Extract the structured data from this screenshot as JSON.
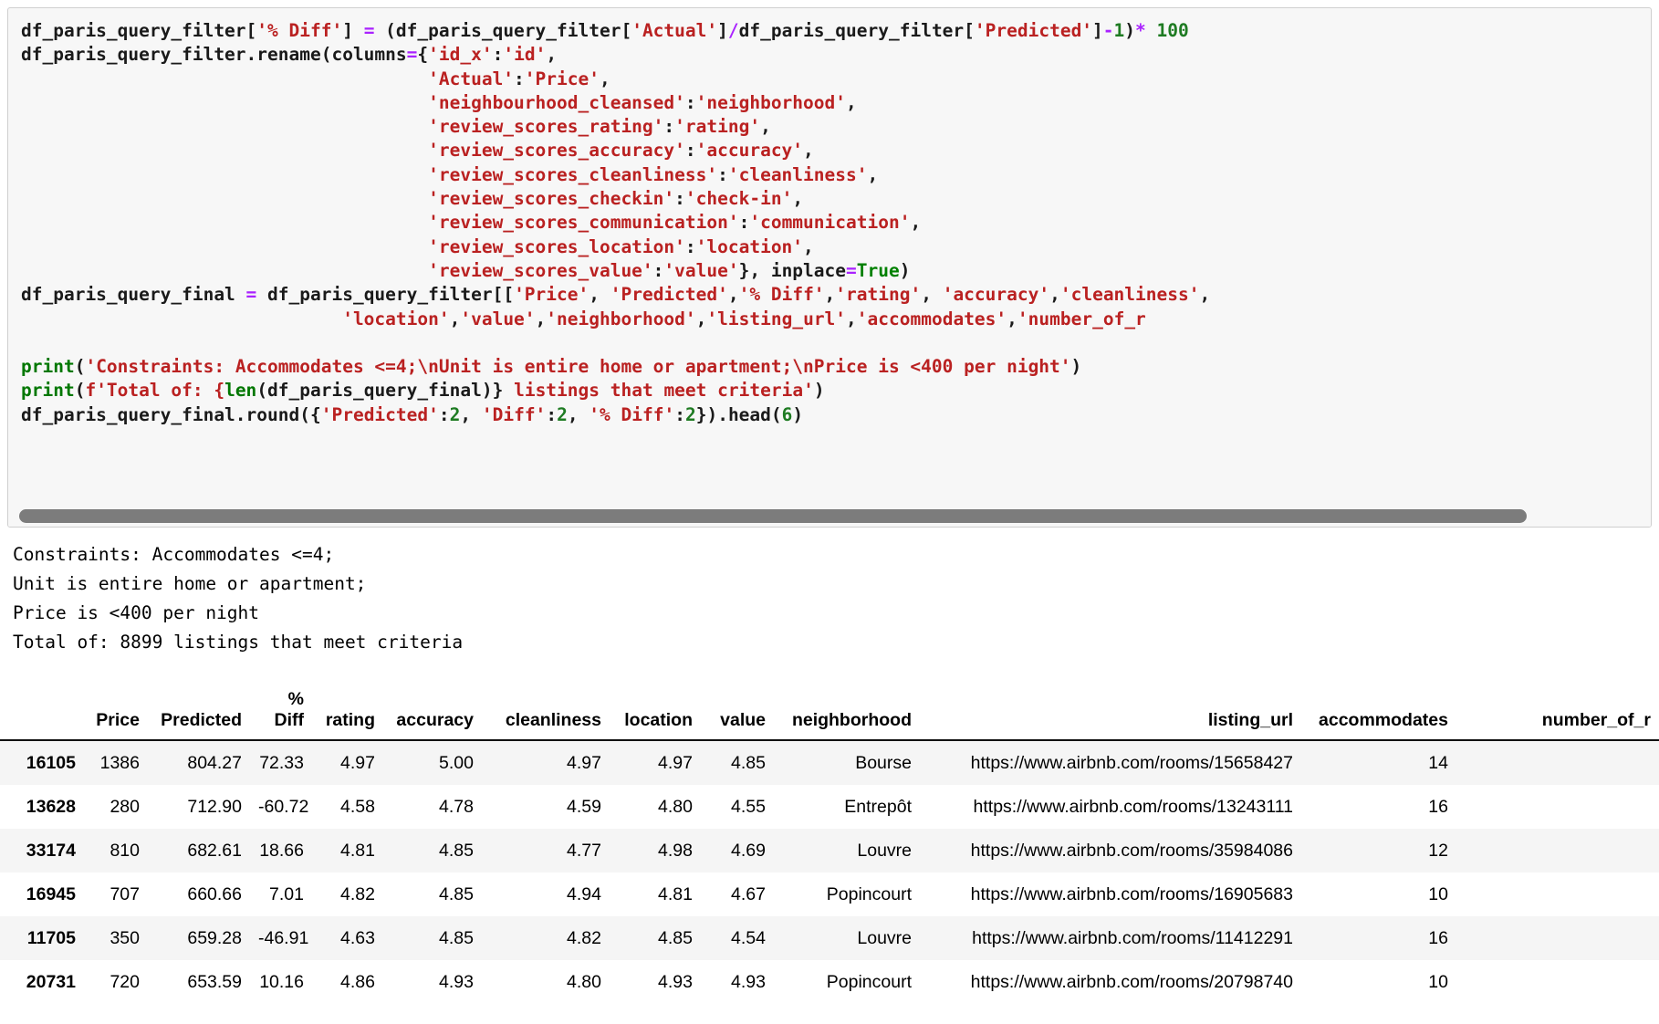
{
  "code_cell": {
    "language": "python",
    "lines": [
      [
        {
          "t": "df_paris_query_filter[",
          "c": "plain"
        },
        {
          "t": "'% Diff'",
          "c": "str"
        },
        {
          "t": "] ",
          "c": "plain"
        },
        {
          "t": "=",
          "c": "op"
        },
        {
          "t": " (df_paris_query_filter[",
          "c": "plain"
        },
        {
          "t": "'Actual'",
          "c": "str"
        },
        {
          "t": "]",
          "c": "plain"
        },
        {
          "t": "/",
          "c": "op"
        },
        {
          "t": "df_paris_query_filter[",
          "c": "plain"
        },
        {
          "t": "'Predicted'",
          "c": "str"
        },
        {
          "t": "]",
          "c": "plain"
        },
        {
          "t": "-",
          "c": "op"
        },
        {
          "t": "1",
          "c": "num"
        },
        {
          "t": ")",
          "c": "plain"
        },
        {
          "t": "*",
          "c": "op"
        },
        {
          "t": " ",
          "c": "plain"
        },
        {
          "t": "100",
          "c": "num"
        }
      ],
      [
        {
          "t": "df_paris_query_filter.rename(columns",
          "c": "plain"
        },
        {
          "t": "=",
          "c": "op"
        },
        {
          "t": "{",
          "c": "plain"
        },
        {
          "t": "'id_x'",
          "c": "str"
        },
        {
          "t": ":",
          "c": "plain"
        },
        {
          "t": "'id'",
          "c": "str"
        },
        {
          "t": ",",
          "c": "plain"
        }
      ],
      [
        {
          "t": "                                      ",
          "c": "plain"
        },
        {
          "t": "'Actual'",
          "c": "str"
        },
        {
          "t": ":",
          "c": "plain"
        },
        {
          "t": "'Price'",
          "c": "str"
        },
        {
          "t": ",",
          "c": "plain"
        }
      ],
      [
        {
          "t": "                                      ",
          "c": "plain"
        },
        {
          "t": "'neighbourhood_cleansed'",
          "c": "str"
        },
        {
          "t": ":",
          "c": "plain"
        },
        {
          "t": "'neighborhood'",
          "c": "str"
        },
        {
          "t": ",",
          "c": "plain"
        }
      ],
      [
        {
          "t": "                                      ",
          "c": "plain"
        },
        {
          "t": "'review_scores_rating'",
          "c": "str"
        },
        {
          "t": ":",
          "c": "plain"
        },
        {
          "t": "'rating'",
          "c": "str"
        },
        {
          "t": ",",
          "c": "plain"
        }
      ],
      [
        {
          "t": "                                      ",
          "c": "plain"
        },
        {
          "t": "'review_scores_accuracy'",
          "c": "str"
        },
        {
          "t": ":",
          "c": "plain"
        },
        {
          "t": "'accuracy'",
          "c": "str"
        },
        {
          "t": ",",
          "c": "plain"
        }
      ],
      [
        {
          "t": "                                      ",
          "c": "plain"
        },
        {
          "t": "'review_scores_cleanliness'",
          "c": "str"
        },
        {
          "t": ":",
          "c": "plain"
        },
        {
          "t": "'cleanliness'",
          "c": "str"
        },
        {
          "t": ",",
          "c": "plain"
        }
      ],
      [
        {
          "t": "                                      ",
          "c": "plain"
        },
        {
          "t": "'review_scores_checkin'",
          "c": "str"
        },
        {
          "t": ":",
          "c": "plain"
        },
        {
          "t": "'check-in'",
          "c": "str"
        },
        {
          "t": ",",
          "c": "plain"
        }
      ],
      [
        {
          "t": "                                      ",
          "c": "plain"
        },
        {
          "t": "'review_scores_communication'",
          "c": "str"
        },
        {
          "t": ":",
          "c": "plain"
        },
        {
          "t": "'communication'",
          "c": "str"
        },
        {
          "t": ",",
          "c": "plain"
        }
      ],
      [
        {
          "t": "                                      ",
          "c": "plain"
        },
        {
          "t": "'review_scores_location'",
          "c": "str"
        },
        {
          "t": ":",
          "c": "plain"
        },
        {
          "t": "'location'",
          "c": "str"
        },
        {
          "t": ",",
          "c": "plain"
        }
      ],
      [
        {
          "t": "                                      ",
          "c": "plain"
        },
        {
          "t": "'review_scores_value'",
          "c": "str"
        },
        {
          "t": ":",
          "c": "plain"
        },
        {
          "t": "'value'",
          "c": "str"
        },
        {
          "t": "}, inplace",
          "c": "plain"
        },
        {
          "t": "=",
          "c": "op"
        },
        {
          "t": "True",
          "c": "bi"
        },
        {
          "t": ")",
          "c": "plain"
        }
      ],
      [
        {
          "t": "df_paris_query_final ",
          "c": "plain"
        },
        {
          "t": "=",
          "c": "op"
        },
        {
          "t": " df_paris_query_filter[[",
          "c": "plain"
        },
        {
          "t": "'Price'",
          "c": "str"
        },
        {
          "t": ", ",
          "c": "plain"
        },
        {
          "t": "'Predicted'",
          "c": "str"
        },
        {
          "t": ",",
          "c": "plain"
        },
        {
          "t": "'% Diff'",
          "c": "str"
        },
        {
          "t": ",",
          "c": "plain"
        },
        {
          "t": "'rating'",
          "c": "str"
        },
        {
          "t": ", ",
          "c": "plain"
        },
        {
          "t": "'accuracy'",
          "c": "str"
        },
        {
          "t": ",",
          "c": "plain"
        },
        {
          "t": "'cleanliness'",
          "c": "str"
        },
        {
          "t": ",",
          "c": "plain"
        }
      ],
      [
        {
          "t": "                              ",
          "c": "plain"
        },
        {
          "t": "'location'",
          "c": "str"
        },
        {
          "t": ",",
          "c": "plain"
        },
        {
          "t": "'value'",
          "c": "str"
        },
        {
          "t": ",",
          "c": "plain"
        },
        {
          "t": "'neighborhood'",
          "c": "str"
        },
        {
          "t": ",",
          "c": "plain"
        },
        {
          "t": "'listing_url'",
          "c": "str"
        },
        {
          "t": ",",
          "c": "plain"
        },
        {
          "t": "'accommodates'",
          "c": "str"
        },
        {
          "t": ",",
          "c": "plain"
        },
        {
          "t": "'number_of_r",
          "c": "str"
        }
      ],
      [],
      [
        {
          "t": "print",
          "c": "kw"
        },
        {
          "t": "(",
          "c": "plain"
        },
        {
          "t": "'Constraints: Accommodates <=4;\\nUnit is entire home or apartment;\\nPrice is <400 per night'",
          "c": "str"
        },
        {
          "t": ")",
          "c": "plain"
        }
      ],
      [
        {
          "t": "print",
          "c": "kw"
        },
        {
          "t": "(",
          "c": "plain"
        },
        {
          "t": "f'Total of: {",
          "c": "str"
        },
        {
          "t": "len",
          "c": "kw"
        },
        {
          "t": "(df_paris_query_final)}",
          "c": "plain"
        },
        {
          "t": " listings that meet criteria'",
          "c": "str"
        },
        {
          "t": ")",
          "c": "plain"
        }
      ],
      [
        {
          "t": "df_paris_query_final.round({",
          "c": "plain"
        },
        {
          "t": "'Predicted'",
          "c": "str"
        },
        {
          "t": ":",
          "c": "plain"
        },
        {
          "t": "2",
          "c": "num"
        },
        {
          "t": ", ",
          "c": "plain"
        },
        {
          "t": "'Diff'",
          "c": "str"
        },
        {
          "t": ":",
          "c": "plain"
        },
        {
          "t": "2",
          "c": "num"
        },
        {
          "t": ", ",
          "c": "plain"
        },
        {
          "t": "'% Diff'",
          "c": "str"
        },
        {
          "t": ":",
          "c": "plain"
        },
        {
          "t": "2",
          "c": "num"
        },
        {
          "t": "}).head(",
          "c": "plain"
        },
        {
          "t": "6",
          "c": "num"
        },
        {
          "t": ")",
          "c": "plain"
        }
      ]
    ],
    "scrollbar": {
      "name": "horizontal-scrollbar"
    }
  },
  "stdout": {
    "lines": [
      "Constraints: Accommodates <=4;",
      "Unit is entire home or apartment;",
      "Price is <400 per night",
      "Total of: 8899 listings that meet criteria"
    ]
  },
  "dataframe": {
    "columns": [
      "",
      "Price",
      "Predicted",
      "%\nDiff",
      "rating",
      "accuracy",
      "cleanliness",
      "location",
      "value",
      "neighborhood",
      "listing_url",
      "accommodates",
      "number_of_r"
    ],
    "headers": {
      "index": "",
      "price": "Price",
      "predicted": "Predicted",
      "pct_diff_top": "%",
      "pct_diff_bottom": "Diff",
      "rating": "rating",
      "accuracy": "accuracy",
      "cleanliness": "cleanliness",
      "location": "location",
      "value": "value",
      "neighborhood": "neighborhood",
      "listing_url": "listing_url",
      "accommodates": "accommodates",
      "number_of_r": "number_of_r"
    },
    "rows": [
      {
        "index": "16105",
        "price": "1386",
        "predicted": "804.27",
        "pct_diff": "72.33",
        "rating": "4.97",
        "accuracy": "5.00",
        "cleanliness": "4.97",
        "location": "4.97",
        "value": "4.85",
        "neighborhood": "Bourse",
        "listing_url": "https://www.airbnb.com/rooms/15658427",
        "accommodates": "14",
        "number_of_r": ""
      },
      {
        "index": "13628",
        "price": "280",
        "predicted": "712.90",
        "pct_diff": "-60.72",
        "rating": "4.58",
        "accuracy": "4.78",
        "cleanliness": "4.59",
        "location": "4.80",
        "value": "4.55",
        "neighborhood": "Entrepôt",
        "listing_url": "https://www.airbnb.com/rooms/13243111",
        "accommodates": "16",
        "number_of_r": ""
      },
      {
        "index": "33174",
        "price": "810",
        "predicted": "682.61",
        "pct_diff": "18.66",
        "rating": "4.81",
        "accuracy": "4.85",
        "cleanliness": "4.77",
        "location": "4.98",
        "value": "4.69",
        "neighborhood": "Louvre",
        "listing_url": "https://www.airbnb.com/rooms/35984086",
        "accommodates": "12",
        "number_of_r": ""
      },
      {
        "index": "16945",
        "price": "707",
        "predicted": "660.66",
        "pct_diff": "7.01",
        "rating": "4.82",
        "accuracy": "4.85",
        "cleanliness": "4.94",
        "location": "4.81",
        "value": "4.67",
        "neighborhood": "Popincourt",
        "listing_url": "https://www.airbnb.com/rooms/16905683",
        "accommodates": "10",
        "number_of_r": ""
      },
      {
        "index": "11705",
        "price": "350",
        "predicted": "659.28",
        "pct_diff": "-46.91",
        "rating": "4.63",
        "accuracy": "4.85",
        "cleanliness": "4.82",
        "location": "4.85",
        "value": "4.54",
        "neighborhood": "Louvre",
        "listing_url": "https://www.airbnb.com/rooms/11412291",
        "accommodates": "16",
        "number_of_r": ""
      },
      {
        "index": "20731",
        "price": "720",
        "predicted": "653.59",
        "pct_diff": "10.16",
        "rating": "4.86",
        "accuracy": "4.93",
        "cleanliness": "4.80",
        "location": "4.93",
        "value": "4.93",
        "neighborhood": "Popincourt",
        "listing_url": "https://www.airbnb.com/rooms/20798740",
        "accommodates": "10",
        "number_of_r": ""
      }
    ]
  },
  "colors": {
    "cell_bg": "#f7f7f7",
    "cell_border": "#cfcfcf",
    "string": "#ba2121",
    "operator": "#aa22ff",
    "number": "#1e7b22",
    "keyword": "#007700",
    "builtin": "#008000",
    "text": "#1a1a1a",
    "scrollbar_thumb": "#7c7c7c",
    "row_stripe": "#f5f5f5"
  }
}
